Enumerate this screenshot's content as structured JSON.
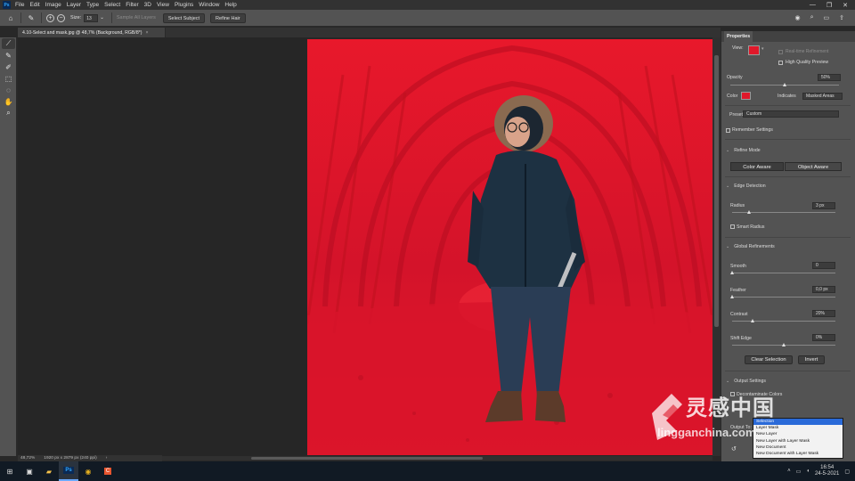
{
  "app": {
    "logo_text": "Ps",
    "menu": [
      "File",
      "Edit",
      "Image",
      "Layer",
      "Type",
      "Select",
      "Filter",
      "3D",
      "View",
      "Plugins",
      "Window",
      "Help"
    ],
    "window_controls": [
      "—",
      "❐",
      "✕"
    ]
  },
  "options_bar": {
    "size_label": "Size:",
    "size_value": "13",
    "sample_all_layers": "Sample All Layers",
    "select_subject": "Select Subject",
    "refine_hair": "Refine Hair"
  },
  "document": {
    "tab_title": "4.10-Select and mask.jpg @ 48,7% (Background, RGB/8*)",
    "zoom": "48,72%",
    "dimensions": "1920 px x 2879 px (240 ppi)"
  },
  "properties": {
    "panel_title": "Properties",
    "view_label": "View:",
    "show_edge": "Real-time Refinement",
    "high_quality_preview": "High Quality Preview",
    "opacity_label": "Opacity",
    "opacity_value": "50%",
    "color_label": "Color",
    "indicates_label": "Indicates",
    "indicates_value": "Masked Areas",
    "preset_label": "Preset",
    "preset_value": "Custom",
    "remember_settings": "Remember Settings",
    "refine_mode_label": "Refine Mode",
    "color_aware": "Color Aware",
    "object_aware": "Object Aware",
    "edge_detection_label": "Edge Detection",
    "radius_label": "Radius",
    "radius_value": "3 px",
    "smart_radius": "Smart Radius",
    "global_refinements_label": "Global Refinements",
    "smooth_label": "Smooth",
    "smooth_value": "0",
    "feather_label": "Feather",
    "feather_value": "0,0 px",
    "contrast_label": "Contrast",
    "contrast_value": "20%",
    "shift_edge_label": "Shift Edge",
    "shift_edge_value": "0%",
    "clear_selection": "Clear Selection",
    "invert": "Invert",
    "output_settings_label": "Output Settings",
    "decontaminate_colors": "Decontaminate Colors",
    "output_to_label": "Output To:",
    "output_options": [
      "Selection",
      "Layer Mask",
      "New Layer",
      "New Layer with Layer Mask",
      "New Document",
      "New Document with Layer Mask"
    ],
    "selected_output": "Selection"
  },
  "taskbar": {
    "time": "16:54",
    "date": "24-5-2021"
  },
  "watermark": {
    "text_cn": "灵感中国",
    "text_url": "lingganchina.com"
  },
  "colors": {
    "overlay_red": "#e0182a",
    "panel_bg": "#535353",
    "accent_blue": "#2a6ad8"
  }
}
